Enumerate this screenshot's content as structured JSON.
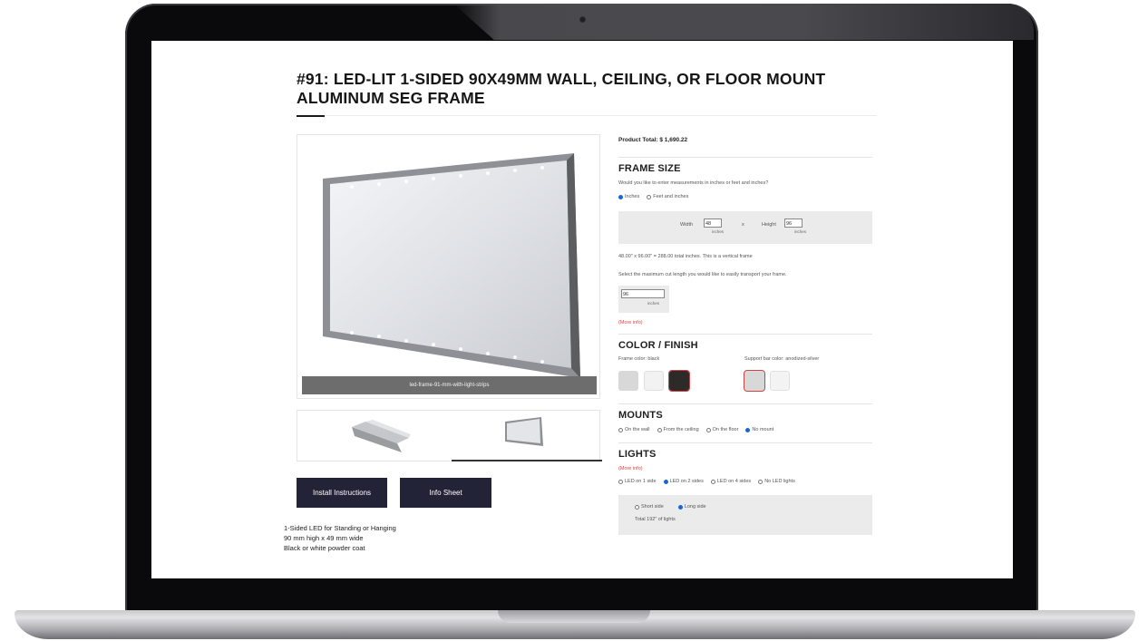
{
  "product": {
    "title": "#91: LED-LIT 1-SIDED 90X49MM WALL, CEILING, OR FLOOR MOUNT ALUMINUM SEG FRAME",
    "image_caption": "led-frame-91-mm-with-light-strips",
    "buttons": {
      "install": "Install Instructions",
      "info": "Info Sheet"
    },
    "features": [
      "1-Sided LED for Standing or Hanging",
      "90 mm high x 49 mm wide",
      "Black or white powder coat"
    ]
  },
  "config": {
    "product_total": "Product Total: $ 1,690.22",
    "frame_size": {
      "heading": "FRAME SIZE",
      "question": "Would you like to enter measurements in inches or feet and inches?",
      "options": [
        "Inches",
        "Feet and inches"
      ],
      "selected": "Inches",
      "width_label": "Width",
      "width_value": "48",
      "height_label": "Height",
      "height_value": "96",
      "times": "x",
      "unit": "inches",
      "summary": "48.00\" x 96.00\" = 288.00 total inches. This is a vertical frame",
      "cut_prompt": "Select the maximum cut length you would like to easily transport your frame.",
      "cut_value": "96",
      "more_info": "(More info)"
    },
    "color": {
      "heading": "COLOR / FINISH",
      "frame_label": "Frame color: black",
      "support_label": "Support bar color: anodized-silver",
      "frame_swatches": [
        "#d8d8d8",
        "#f2f2f2",
        "#2e2a2a"
      ],
      "support_swatches": [
        "#d8d8d8",
        "#f3f3f3"
      ]
    },
    "mounts": {
      "heading": "MOUNTS",
      "options": [
        "On the wall",
        "From the ceiling",
        "On the floor",
        "No mount"
      ],
      "selected": "No mount"
    },
    "lights": {
      "heading": "LIGHTS",
      "more_info": "(More info)",
      "options": [
        "LED on 1 side",
        "LED on 2 sides",
        "LED on 4 sides",
        "No LED lights"
      ],
      "selected": "LED on 2 sides",
      "side_options": [
        "Short side",
        "Long side"
      ],
      "side_selected": "Long side",
      "total": "Total 192\" of lights"
    }
  }
}
